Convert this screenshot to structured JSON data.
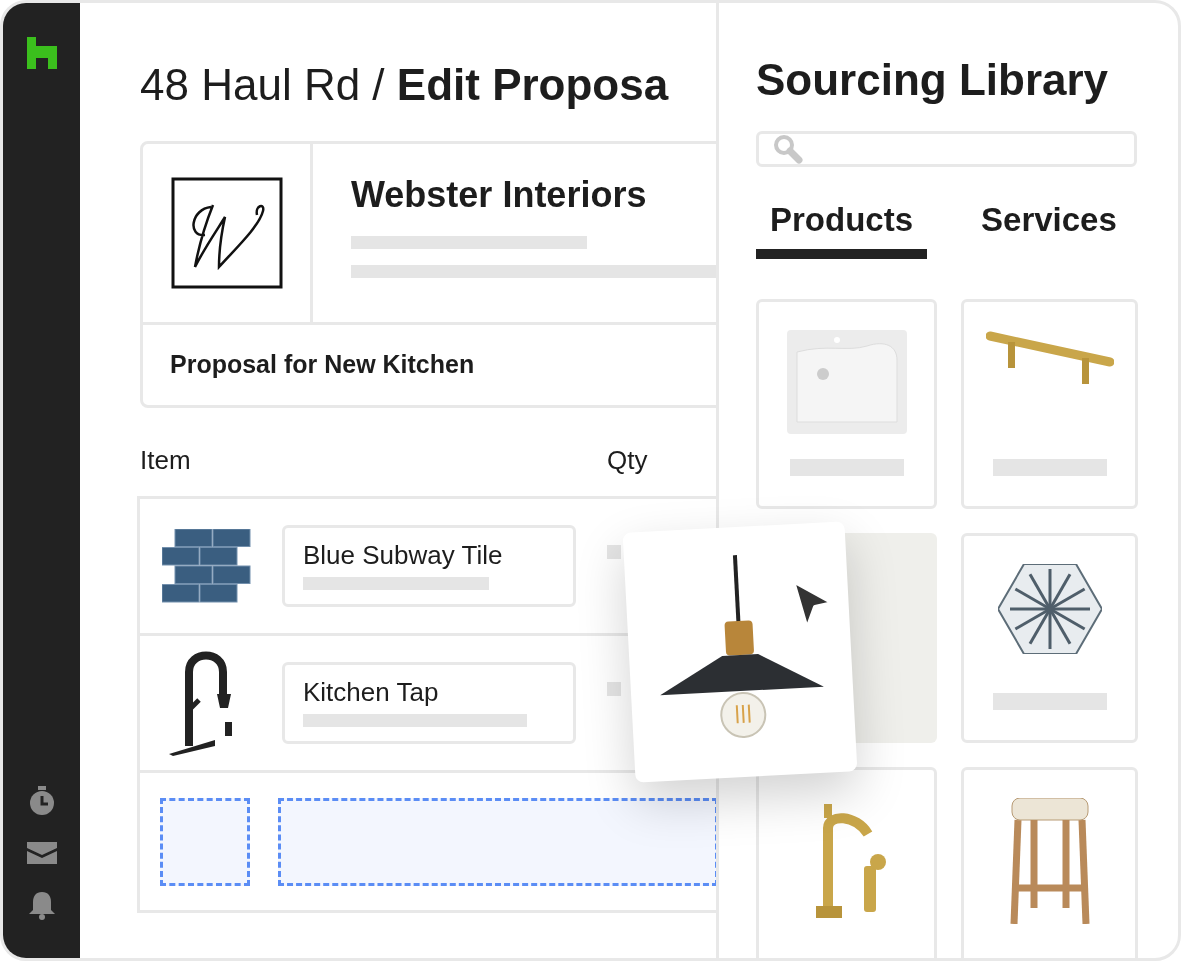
{
  "header": {
    "title": "48 Haul Rd / **Edit Proposa**"
  },
  "company": {
    "name": "Webster Interiors"
  },
  "proposal": {
    "title": "Proposal for New Kitchen"
  },
  "table": {
    "columns": [
      "Item",
      "Qty"
    ],
    "rows": [
      {
        "kind": "tile",
        "name": "Blue Subway Tile"
      },
      {
        "kind": "tap",
        "name": "Kitchen Tap"
      },
      {
        "kind": "drop"
      }
    ]
  },
  "library": {
    "title": "Sourcing Library",
    "tabs": [
      {
        "label": "Products",
        "selected": true
      },
      {
        "label": "Services",
        "selected": false
      }
    ],
    "products": [
      {
        "kind": "sink"
      },
      {
        "kind": "handle"
      },
      {
        "kind": "empty"
      },
      {
        "kind": "hex-tile"
      },
      {
        "kind": "faucet"
      },
      {
        "kind": "stool"
      }
    ]
  },
  "dragged": {
    "kind": "pendant-lamp"
  }
}
